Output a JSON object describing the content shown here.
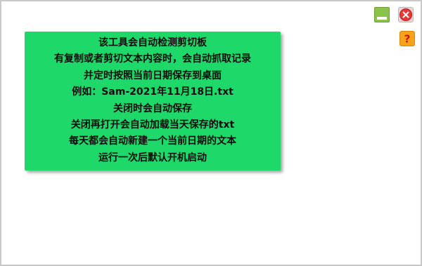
{
  "window_controls": {
    "minimize_icon": "minimize-icon",
    "close_icon": "close-icon",
    "help_icon": "question-mark-icon",
    "help_glyph": "?",
    "minimize_color": "#8bc34a",
    "close_color": "#e53935",
    "help_color": "#f7a21b"
  },
  "panel": {
    "background": "#1fd86a",
    "lines": [
      "该工具会自动检测剪切板",
      "有复制或者剪切文本内容时，会自动抓取记录",
      "并定时按照当前日期保存到桌面",
      "例如：Sam-2021年11月18日.txt",
      "关闭时会自动保存",
      "关闭再打开会自动加载当天保存的txt",
      "每天都会自动新建一个当前日期的文本",
      "运行一次后默认开机启动"
    ]
  }
}
